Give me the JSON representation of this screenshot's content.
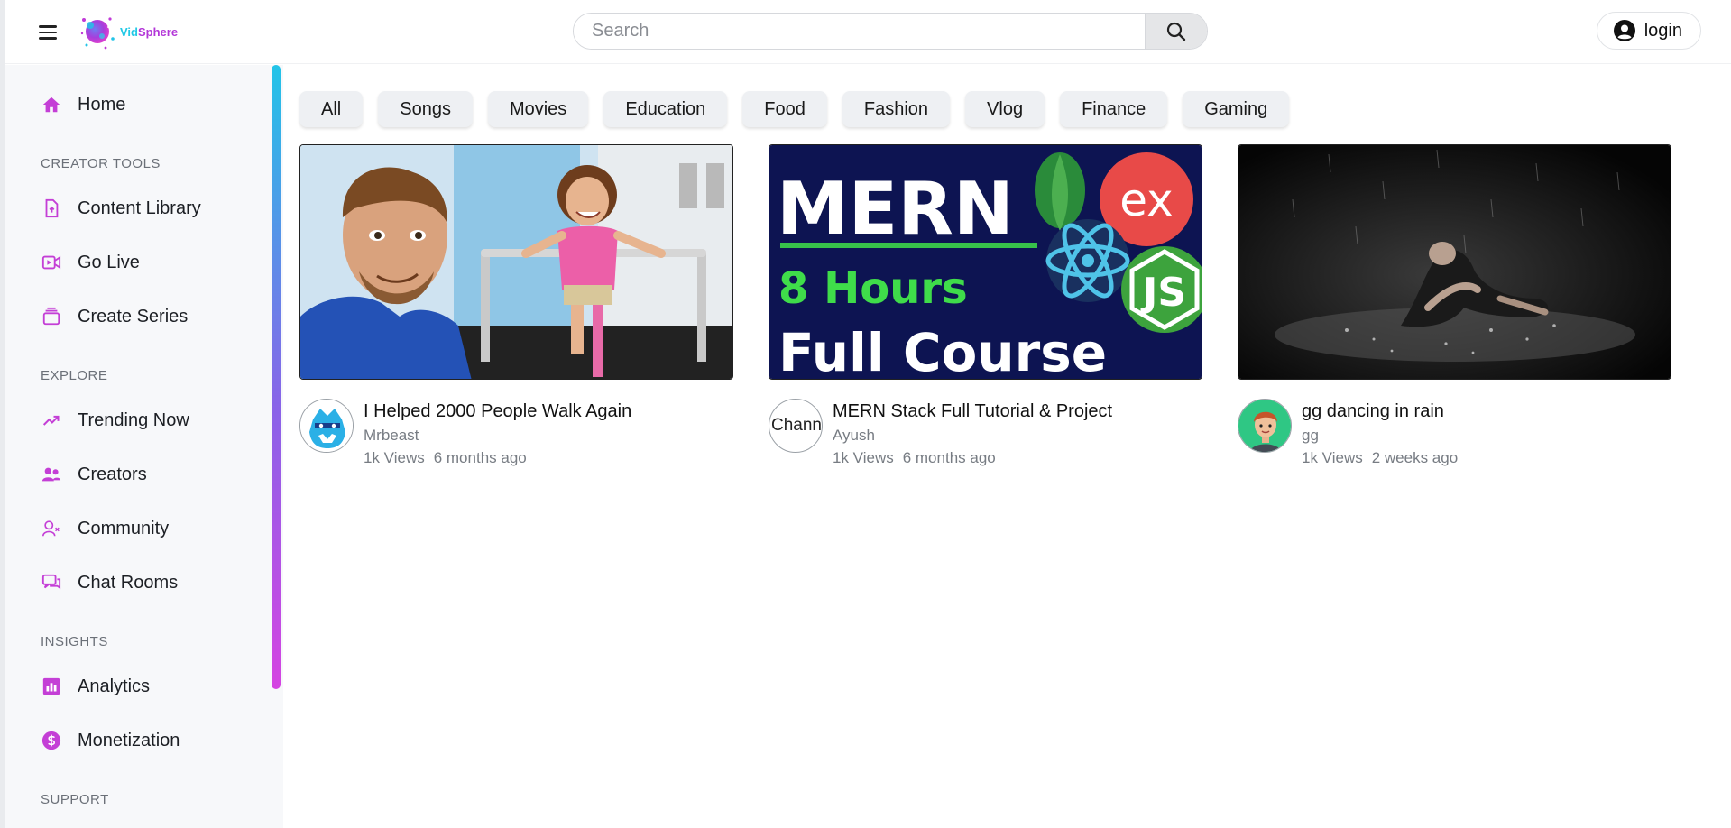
{
  "app": {
    "brand_part1": "Vid",
    "brand_part2": "Sphere",
    "accent_gradient_start": "#22c4e8",
    "accent_gradient_end": "#d544e2",
    "brand_purple": "#b337d8"
  },
  "header": {
    "menu_icon": "hamburger-menu-icon",
    "search_placeholder": "Search",
    "search_icon": "search-icon",
    "login_label": "login",
    "login_icon": "user-circle-icon"
  },
  "sidebar": {
    "home": {
      "label": "Home",
      "icon": "home-icon"
    },
    "sections": {
      "creator_tools": "CREATOR TOOLS",
      "explore": "EXPLORE",
      "insights": "INSIGHTS",
      "support": "SUPPORT"
    },
    "creator_tools": [
      {
        "label": "Content Library",
        "icon": "file-upload-icon"
      },
      {
        "label": "Go Live",
        "icon": "video-camera-icon"
      },
      {
        "label": "Create Series",
        "icon": "collection-icon"
      }
    ],
    "explore": [
      {
        "label": "Trending Now",
        "icon": "trending-up-icon"
      },
      {
        "label": "Creators",
        "icon": "users-icon"
      },
      {
        "label": "Community",
        "icon": "community-icon"
      },
      {
        "label": "Chat Rooms",
        "icon": "chat-icon"
      }
    ],
    "insights": [
      {
        "label": "Analytics",
        "icon": "bar-chart-icon"
      },
      {
        "label": "Monetization",
        "icon": "dollar-circle-icon"
      }
    ]
  },
  "categories": [
    "All",
    "Songs",
    "Movies",
    "Education",
    "Food",
    "Fashion",
    "Vlog",
    "Finance",
    "Gaming"
  ],
  "videos": [
    {
      "title": "I Helped 2000 People Walk Again",
      "channel": "Mrbeast",
      "views": "1k Views",
      "age": "6 months ago"
    },
    {
      "title": "MERN Stack Full Tutorial & Project",
      "channel": "Ayush",
      "views": "1k Views",
      "age": "6 months ago",
      "avatar_alt": "Chann",
      "thumb_line1": "MERN",
      "thumb_line2": "8 Hours",
      "thumb_line3": "Full Course",
      "thumb_badge_ex": "ex",
      "thumb_badge_js": "JS"
    },
    {
      "title": "gg dancing in rain",
      "channel": "gg",
      "views": "1k Views",
      "age": "2 weeks ago"
    }
  ]
}
